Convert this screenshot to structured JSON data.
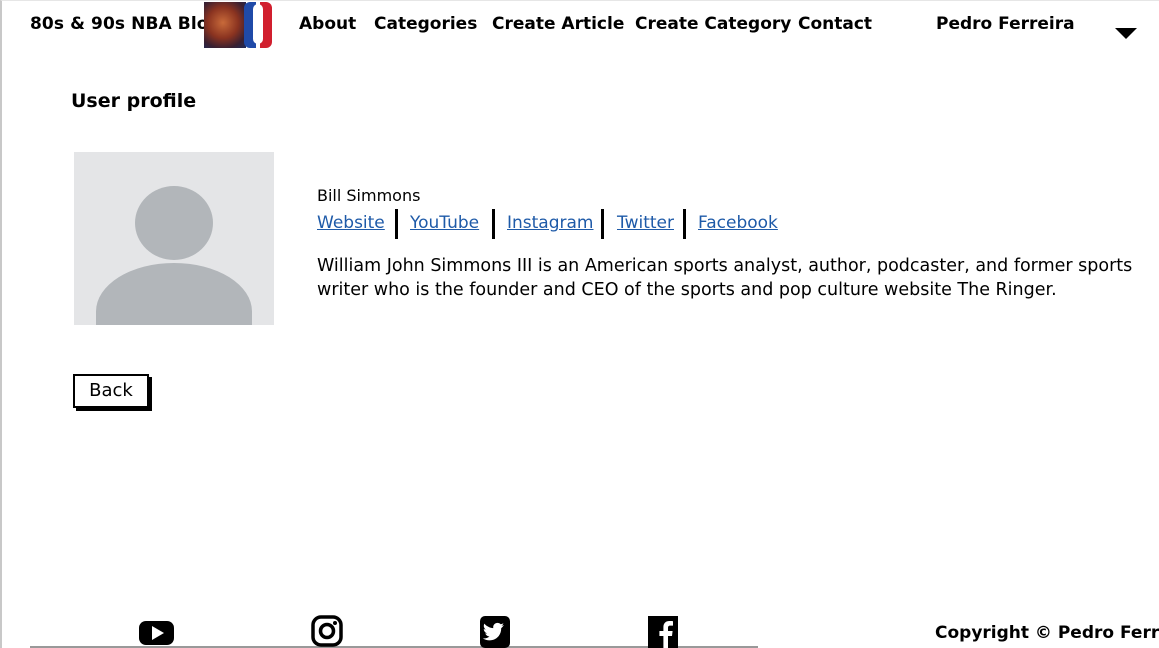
{
  "header": {
    "brand": "80s & 90s NBA Blog",
    "nav": [
      {
        "label": "About"
      },
      {
        "label": "Categories"
      },
      {
        "label": "Create Article"
      },
      {
        "label": "Create Category"
      },
      {
        "label": "Contact"
      }
    ],
    "user_name": "Pedro Ferreira"
  },
  "main": {
    "title": "User profile",
    "profile": {
      "name": "Bill Simmons",
      "links": [
        "Website",
        "YouTube",
        "Instagram",
        "Twitter",
        "Facebook"
      ],
      "bio": "William John Simmons III is an American sports analyst, author, podcaster, and former sports writer who is the founder and CEO of the sports and pop culture website The Ringer."
    },
    "back_label": "Back"
  },
  "footer": {
    "icons": [
      "youtube-icon",
      "instagram-icon",
      "twitter-icon",
      "facebook-icon"
    ],
    "copyright": "Copyright © Pedro Ferreira"
  },
  "colors": {
    "link": "#1e5aa8",
    "avatar_bg": "#e4e5e7",
    "avatar_fg": "#b2b6ba"
  }
}
